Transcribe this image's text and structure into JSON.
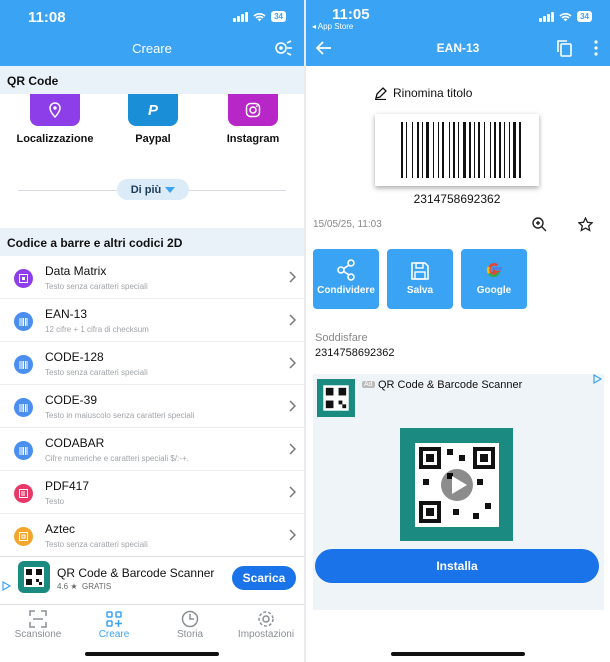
{
  "left": {
    "status": {
      "time": "11:08",
      "battery": "34"
    },
    "nav": {
      "title": "Creare"
    },
    "qr_section": {
      "title": "QR Code"
    },
    "qr_cards": [
      {
        "label": "Localizzazione",
        "color": "#8e3ee8",
        "icon": "location-pin-icon"
      },
      {
        "label": "Paypal",
        "color": "#1a8fd8",
        "icon": "paypal-icon"
      },
      {
        "label": "Instagram",
        "color": "#b726c7",
        "icon": "instagram-icon"
      }
    ],
    "more_button": "Di più",
    "barcode_section": {
      "title": "Codice a barre e altri codici 2D"
    },
    "codes": [
      {
        "name": "Data Matrix",
        "desc": "Testo senza caratteri speciali",
        "color": "#8e3ee8"
      },
      {
        "name": "EAN-13",
        "desc": "12 cifre + 1 cifra di checksum",
        "color": "#4a8ff0"
      },
      {
        "name": "CODE-128",
        "desc": "Testo senza caratteri speciali",
        "color": "#4a8ff0"
      },
      {
        "name": "CODE-39",
        "desc": "Testo in maiuscolo senza caratteri speciali",
        "color": "#4a8ff0"
      },
      {
        "name": "CODABAR",
        "desc": "Cifre numeriche e caratteri speciali $/:-+.",
        "color": "#4a8ff0"
      },
      {
        "name": "PDF417",
        "desc": "Testo",
        "color": "#e8386a"
      },
      {
        "name": "Aztec",
        "desc": "Testo senza caratteri speciali",
        "color": "#f2a630"
      }
    ],
    "ad": {
      "name": "QR Code & Barcode Scanner",
      "rating": "4.6 ★",
      "price": "GRATIS",
      "button": "Scarica"
    },
    "tabs": [
      {
        "label": "Scansione",
        "active": false
      },
      {
        "label": "Creare",
        "active": true
      },
      {
        "label": "Storia",
        "active": false
      },
      {
        "label": "Impostazioni",
        "active": false
      }
    ]
  },
  "right": {
    "status": {
      "time": "11:05",
      "battery": "34",
      "back_app": "◂ App Store"
    },
    "nav": {
      "title": "EAN-13"
    },
    "rename": "Rinomina titolo",
    "barcode_number": "2314758692362",
    "datetime": "15/05/25, 11:03",
    "actions": [
      {
        "label": "Condividere",
        "icon": "share-icon"
      },
      {
        "label": "Salva",
        "icon": "save-icon"
      },
      {
        "label": "Google",
        "icon": "google-icon"
      }
    ],
    "content_label": "Soddisfare",
    "content_value": "2314758692362",
    "ad": {
      "badge": "Ad",
      "name": "QR Code & Barcode Scanner",
      "button": "Installa"
    }
  },
  "colors": {
    "primary": "#3ba3f3",
    "ad_button": "#1a73e8",
    "app_teal": "#1b8b82"
  }
}
